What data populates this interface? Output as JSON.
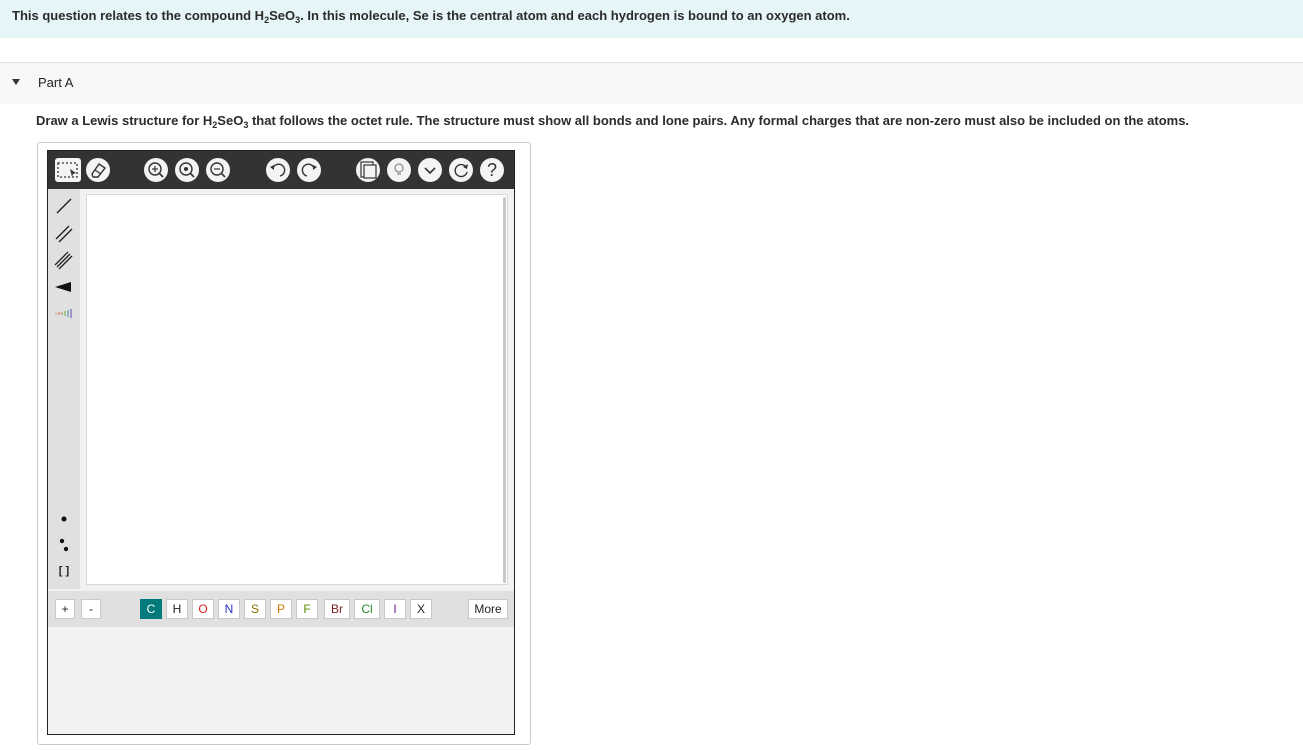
{
  "question": {
    "prefix": "This question relates to the compound H",
    "sub1": "2",
    "mid": "SeO",
    "sub2": "3",
    "suffix": ". In this molecule, Se is the central atom and each hydrogen is bound to an oxygen atom."
  },
  "part": {
    "label": "Part A"
  },
  "prompt": {
    "prefix": "Draw a Lewis structure for H",
    "sub1": "2",
    "mid": "SeO",
    "sub2": "3",
    "suffix": " that follows the octet rule. The structure must show all bonds and lone pairs. Any formal charges that are non-zero must also be included on the atoms."
  },
  "toolbar": {
    "icons": [
      "select-icon",
      "eraser-icon",
      "zoom-fit-icon",
      "zoom-in-icon",
      "zoom-out-icon",
      "undo-icon",
      "redo-icon",
      "template-icon",
      "hint-icon",
      "chevron-down-icon",
      "reset-icon",
      "help-icon"
    ],
    "help_label": "?"
  },
  "left_tools": [
    "single-bond-icon",
    "double-bond-icon",
    "triple-bond-icon",
    "wedge-bond-icon",
    "hash-bond-icon",
    "radical-icon",
    "lone-pair-icon",
    "bracket-icon"
  ],
  "bracket_label": "[ ]",
  "charges": {
    "plus": "+",
    "minus": "-"
  },
  "elements": [
    {
      "symbol": "C",
      "color": "#ffffff",
      "selected": true
    },
    {
      "symbol": "H",
      "color": "#222222",
      "selected": false
    },
    {
      "symbol": "O",
      "color": "#e02020",
      "selected": false
    },
    {
      "symbol": "N",
      "color": "#2033c8",
      "selected": false
    },
    {
      "symbol": "S",
      "color": "#8a6d00",
      "selected": false
    },
    {
      "symbol": "P",
      "color": "#d07a00",
      "selected": false
    },
    {
      "symbol": "F",
      "color": "#5a8a00",
      "selected": false
    },
    {
      "symbol": "Br",
      "color": "#7a1f1f",
      "selected": false
    },
    {
      "symbol": "Cl",
      "color": "#2a8a2a",
      "selected": false
    },
    {
      "symbol": "I",
      "color": "#6a1a8a",
      "selected": false
    },
    {
      "symbol": "X",
      "color": "#222222",
      "selected": false
    }
  ],
  "more_label": "More"
}
